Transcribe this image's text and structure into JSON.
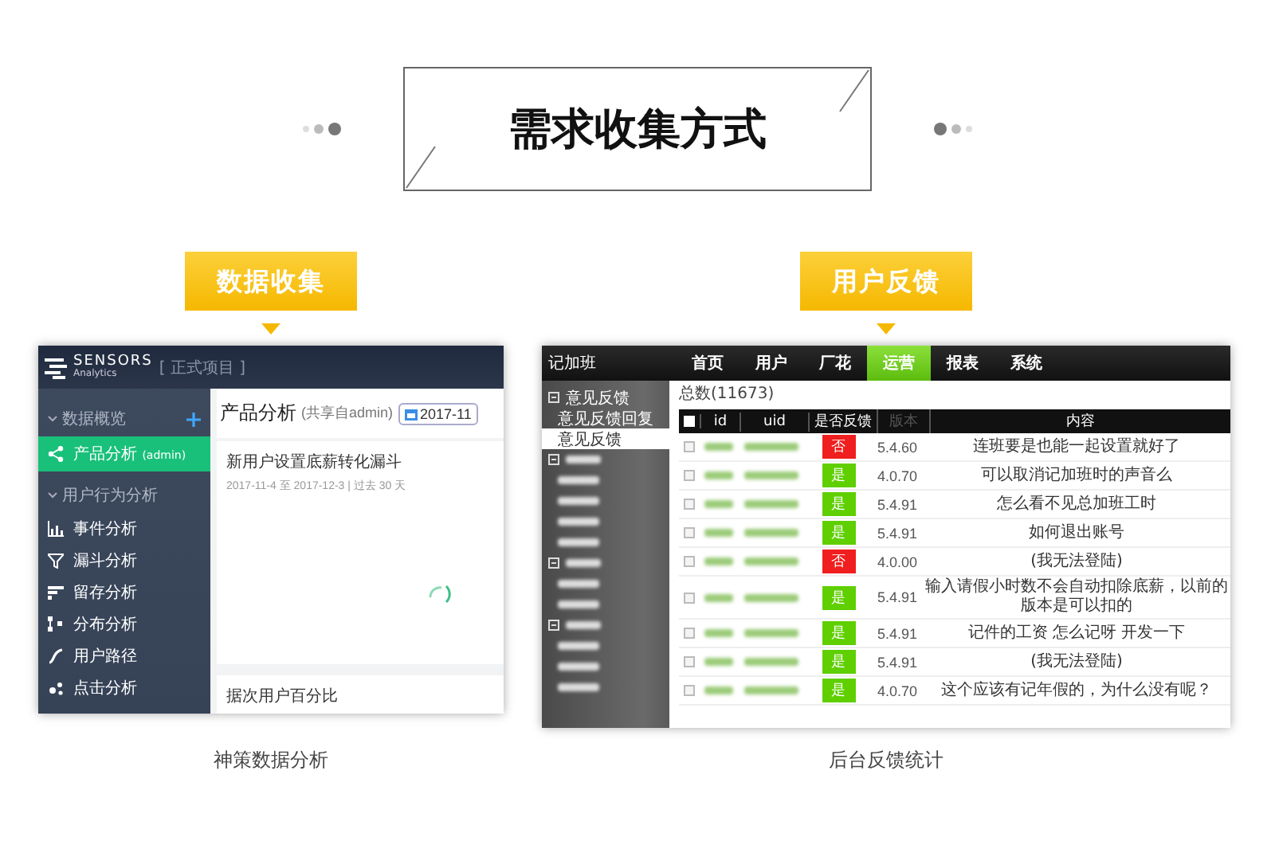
{
  "title": "需求收集方式",
  "left": {
    "label": "数据收集",
    "caption": "神策数据分析",
    "app": {
      "logo": "SENSORS",
      "logo_sub": "Analytics",
      "project": "[ 正式项目 ]",
      "sidebar": [
        {
          "kind": "group",
          "label": "数据概览"
        },
        {
          "kind": "item",
          "label": "产品分析",
          "note": "(admin)",
          "selected": true
        },
        {
          "kind": "group",
          "label": "用户行为分析"
        },
        {
          "kind": "item",
          "label": "事件分析",
          "selected": false
        },
        {
          "kind": "item",
          "label": "漏斗分析",
          "selected": false
        },
        {
          "kind": "item",
          "label": "留存分析",
          "selected": false
        },
        {
          "kind": "item",
          "label": "分布分析",
          "selected": false
        },
        {
          "kind": "item",
          "label": "用户路径",
          "selected": false
        },
        {
          "kind": "item",
          "label": "点击分析",
          "selected": false
        }
      ],
      "page_title": "产品分析",
      "page_subtitle": "(共享自admin)",
      "date": "2017-11",
      "cards": [
        {
          "title": "新用户设置底薪转化漏斗",
          "subtitle": "2017-11-4 至 2017-12-3 | 过去 30 天",
          "loading": true
        },
        {
          "title": "据次用户百分比",
          "loading": false
        }
      ]
    }
  },
  "right": {
    "label": "用户反馈",
    "caption": "后台反馈统计",
    "app": {
      "logo": "记加班",
      "nav": [
        {
          "label": "首页",
          "selected": false
        },
        {
          "label": "用户",
          "selected": false
        },
        {
          "label": "厂花",
          "selected": false
        },
        {
          "label": "运营",
          "selected": true
        },
        {
          "label": "报表",
          "selected": false
        },
        {
          "label": "系统",
          "selected": false
        }
      ],
      "sidebar": [
        {
          "kind": "group",
          "label": "意见反馈"
        },
        {
          "kind": "item",
          "label": "意见反馈回复",
          "selected": false
        },
        {
          "kind": "item",
          "label": "意见反馈",
          "selected": true
        },
        {
          "kind": "blurred-group"
        },
        {
          "kind": "blurred-item"
        },
        {
          "kind": "blurred-item"
        },
        {
          "kind": "blurred-item"
        },
        {
          "kind": "blurred-item"
        },
        {
          "kind": "blurred-group"
        },
        {
          "kind": "blurred-item"
        },
        {
          "kind": "blurred-item"
        },
        {
          "kind": "blurred-group"
        },
        {
          "kind": "blurred-item"
        },
        {
          "kind": "blurred-item"
        },
        {
          "kind": "blurred-item"
        }
      ],
      "total": "总数(11673)",
      "columns": [
        "id",
        "uid",
        "是否反馈",
        "版本",
        "内容"
      ],
      "rows": [
        {
          "checked": false,
          "feedback": "否",
          "replied": false,
          "version": "5.4.60",
          "content": "连班要是也能一起设置就好了"
        },
        {
          "checked": false,
          "feedback": "是",
          "replied": true,
          "version": "4.0.70",
          "content": "可以取消记加班时的声音么"
        },
        {
          "checked": false,
          "feedback": "是",
          "replied": true,
          "version": "5.4.91",
          "content": "怎么看不见总加班工时"
        },
        {
          "checked": false,
          "feedback": "是",
          "replied": true,
          "version": "5.4.91",
          "content": "如何退出账号"
        },
        {
          "checked": false,
          "feedback": "否",
          "replied": false,
          "version": "4.0.00",
          "content": "(我无法登陆)"
        },
        {
          "checked": false,
          "feedback": "是",
          "replied": true,
          "version": "5.4.91",
          "content": "输入请假小时数不会自动扣除底薪，以前的版本是可以扣的"
        },
        {
          "checked": false,
          "feedback": "是",
          "replied": true,
          "version": "5.4.91",
          "content": "记件的工资 怎么记呀 开发一下"
        },
        {
          "checked": false,
          "feedback": "是",
          "replied": true,
          "version": "5.4.91",
          "content": "(我无法登陆)"
        },
        {
          "checked": false,
          "feedback": "是",
          "replied": true,
          "version": "4.0.70",
          "content": "这个应该有记年假的，为什么没有呢？"
        }
      ]
    }
  }
}
